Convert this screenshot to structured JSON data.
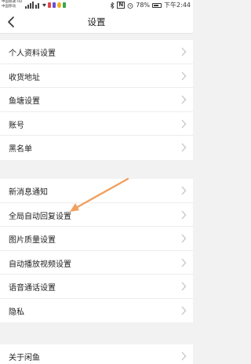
{
  "status_bar": {
    "carrier_line1": "中国联通 HD",
    "carrier_line2": "中国移动",
    "battery_percent_text": "78%",
    "battery_level": 0.78,
    "time": "下午2:44"
  },
  "header": {
    "title": "设置",
    "back_icon": "chevron-left-icon"
  },
  "sections": [
    {
      "items": [
        {
          "label": "个人资料设置"
        },
        {
          "label": "收货地址"
        },
        {
          "label": "鱼塘设置"
        },
        {
          "label": "账号"
        },
        {
          "label": "黑名单"
        }
      ]
    },
    {
      "items": [
        {
          "label": "新消息通知"
        },
        {
          "label": "全局自动回复设置"
        },
        {
          "label": "图片质量设置"
        },
        {
          "label": "自动播放视频设置"
        },
        {
          "label": "语音通话设置"
        },
        {
          "label": "隐私"
        }
      ]
    },
    {
      "items": [
        {
          "label": "关于闲鱼"
        }
      ]
    }
  ],
  "colors": {
    "annotation_arrow": "#f0a060",
    "chevron": "#c4c4c4",
    "background": "#f2f2f2"
  }
}
